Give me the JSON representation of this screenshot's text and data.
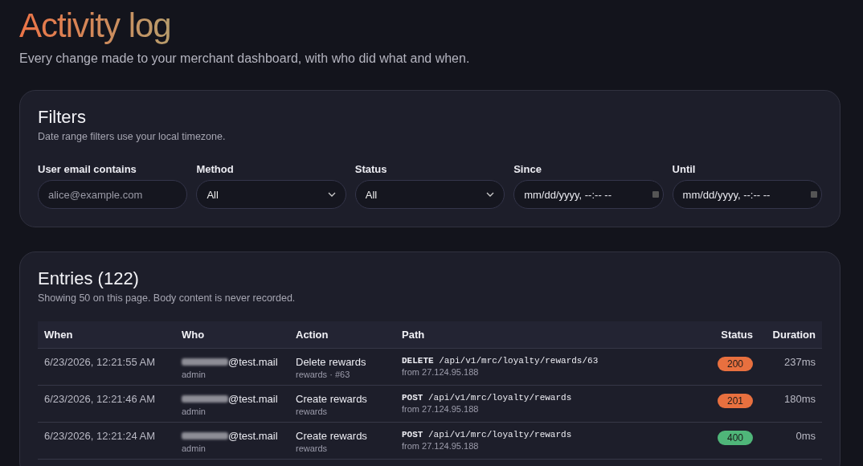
{
  "header": {
    "title": "Activity log",
    "subtitle": "Every change made to your merchant dashboard, with who did what and when."
  },
  "filters": {
    "title": "Filters",
    "note": "Date range filters use your local timezone.",
    "fields": [
      {
        "kind": "text",
        "label": "User email contains",
        "placeholder": "alice@example.com"
      },
      {
        "kind": "select",
        "label": "Method",
        "value": "All"
      },
      {
        "kind": "select",
        "label": "Status",
        "value": "All"
      },
      {
        "kind": "date",
        "label": "Since",
        "placeholder": "mm/dd/yyyy, --:-- --"
      },
      {
        "kind": "date",
        "label": "Until",
        "placeholder": "mm/dd/yyyy, --:-- --"
      }
    ]
  },
  "entries": {
    "title": "Entries (122)",
    "note": "Showing 50 on this page. Body content is never recorded.",
    "columns": [
      "When",
      "Who",
      "Action",
      "Path",
      "Status",
      "Duration"
    ],
    "rows": [
      {
        "when": "6/23/2026, 12:21:55 AM",
        "email": "@test.mail",
        "role": "admin",
        "action": "Delete rewards",
        "target": "rewards · #63",
        "method": "DELETE",
        "path": "/api/v1/mrc/loyalty/rewards/63",
        "from": "from 27.124.95.188",
        "status": "200",
        "color": "#e8703f",
        "duration": "237ms"
      },
      {
        "when": "6/23/2026, 12:21:46 AM",
        "email": "@test.mail",
        "role": "admin",
        "action": "Create rewards",
        "target": "rewards",
        "method": "POST",
        "path": "/api/v1/mrc/loyalty/rewards",
        "from": "from 27.124.95.188",
        "status": "201",
        "color": "#e8703f",
        "duration": "180ms"
      },
      {
        "when": "6/23/2026, 12:21:24 AM",
        "email": "@test.mail",
        "role": "admin",
        "action": "Create rewards",
        "target": "rewards",
        "method": "POST",
        "path": "/api/v1/mrc/loyalty/rewards",
        "from": "from 27.124.95.188",
        "status": "400",
        "color": "#4fb679",
        "duration": "0ms"
      }
    ]
  }
}
